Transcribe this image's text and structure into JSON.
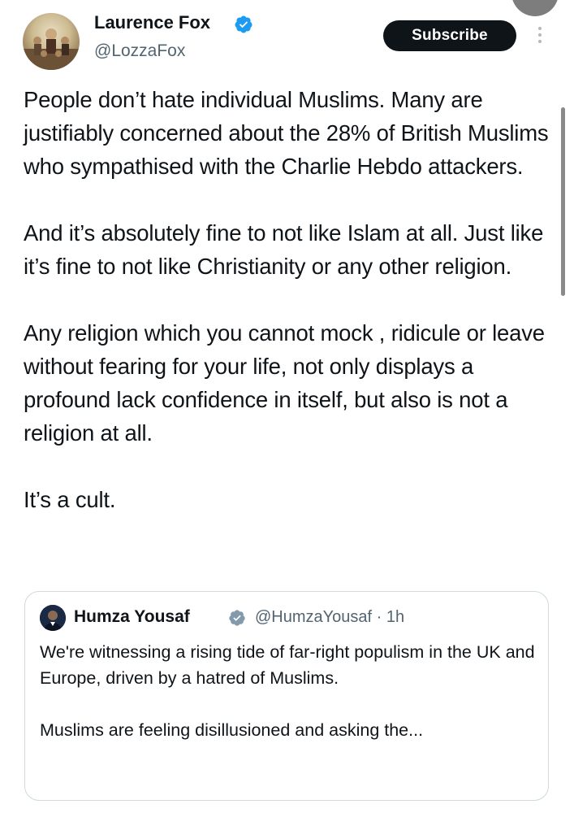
{
  "post": {
    "author_name": "Laurence Fox",
    "author_handle": "@LozzaFox",
    "subscribe_label": "Subscribe",
    "paragraphs": [
      "People don’t hate individual Muslims. Many are justifiably concerned about the 28% of British Muslims who sympathised with the Charlie Hebdo attackers.",
      "And it’s absolutely fine to not like Islam at all. Just like it’s fine to not like Christianity or any other religion.",
      "Any religion which you cannot mock , ridicule or leave without fearing for your life, not only displays a profound lack confidence in itself, but also is not a religion at all.",
      "It’s a cult."
    ]
  },
  "quoted": {
    "author_name": "Humza Yousaf",
    "author_handle_time": "@HumzaYousaf · 1h",
    "paragraphs": [
      "We're witnessing a rising tide of far-right populism in the UK and Europe, driven by a hatred of Muslims.",
      "Muslims are feeling disillusioned and asking the..."
    ]
  },
  "icons": {
    "verified": "verified-badge-icon",
    "more": "more-options-icon"
  },
  "colors": {
    "text": "#0f1419",
    "secondary": "#536471",
    "verified_blue": "#1d9bf0",
    "verified_gray": "#829aab",
    "button_bg": "#0f1419",
    "border": "#cfd9de"
  }
}
